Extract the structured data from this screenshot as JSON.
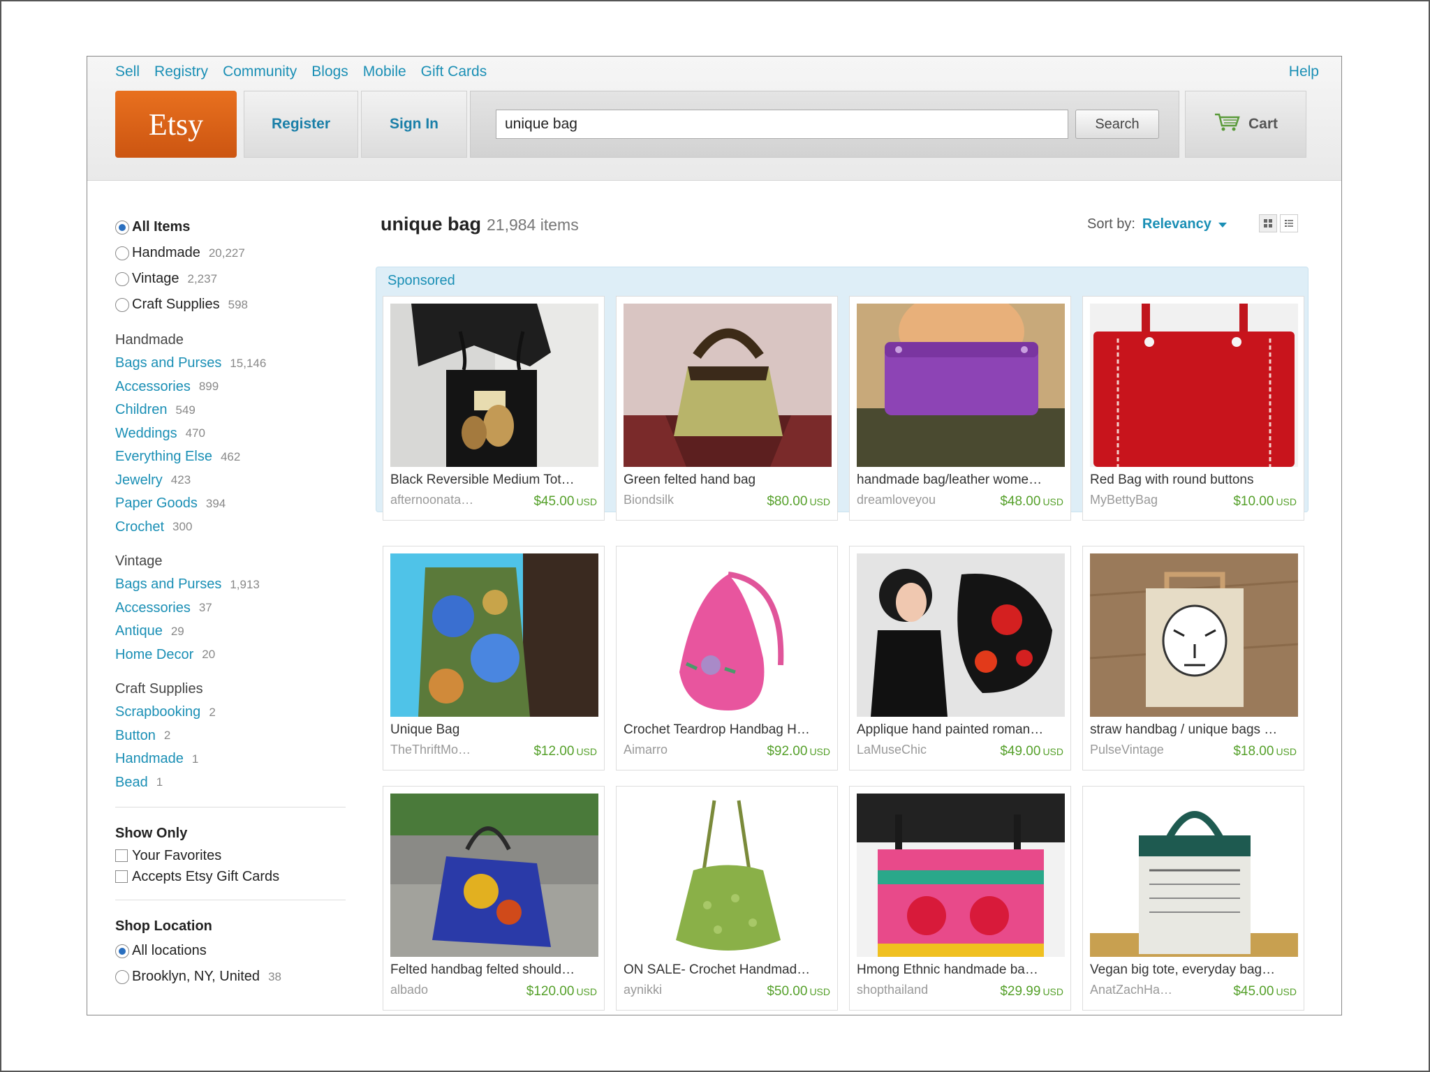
{
  "top_nav": {
    "links": [
      "Sell",
      "Registry",
      "Community",
      "Blogs",
      "Mobile",
      "Gift Cards"
    ],
    "help": "Help"
  },
  "header": {
    "logo": "Etsy",
    "register": "Register",
    "sign_in": "Sign In",
    "search_value": "unique bag",
    "search_button": "Search",
    "cart": "Cart"
  },
  "filters": {
    "types": [
      {
        "label": "All Items",
        "count": "",
        "checked": true
      },
      {
        "label": "Handmade",
        "count": "20,227",
        "checked": false
      },
      {
        "label": "Vintage",
        "count": "2,237",
        "checked": false
      },
      {
        "label": "Craft Supplies",
        "count": "598",
        "checked": false
      }
    ],
    "handmade": {
      "heading": "Handmade",
      "items": [
        {
          "label": "Bags and Purses",
          "count": "15,146"
        },
        {
          "label": "Accessories",
          "count": "899"
        },
        {
          "label": "Children",
          "count": "549"
        },
        {
          "label": "Weddings",
          "count": "470"
        },
        {
          "label": "Everything Else",
          "count": "462"
        },
        {
          "label": "Jewelry",
          "count": "423"
        },
        {
          "label": "Paper Goods",
          "count": "394"
        },
        {
          "label": "Crochet",
          "count": "300"
        }
      ]
    },
    "vintage": {
      "heading": "Vintage",
      "items": [
        {
          "label": "Bags and Purses",
          "count": "1,913"
        },
        {
          "label": "Accessories",
          "count": "37"
        },
        {
          "label": "Antique",
          "count": "29"
        },
        {
          "label": "Home Decor",
          "count": "20"
        }
      ]
    },
    "craft": {
      "heading": "Craft Supplies",
      "items": [
        {
          "label": "Scrapbooking",
          "count": "2"
        },
        {
          "label": "Button",
          "count": "2"
        },
        {
          "label": "Handmade",
          "count": "1"
        },
        {
          "label": "Bead",
          "count": "1"
        }
      ]
    },
    "show_only": {
      "heading": "Show Only",
      "options": [
        "Your Favorites",
        "Accepts Etsy Gift Cards"
      ]
    },
    "shop_location": {
      "heading": "Shop Location",
      "options": [
        {
          "label": "All locations",
          "count": "",
          "checked": true
        },
        {
          "label": "Brooklyn, NY, United",
          "count": "38",
          "checked": false
        }
      ]
    }
  },
  "results": {
    "query": "unique bag",
    "count": "21,984 items",
    "sort_label": "Sort by:",
    "sort_value": "Relevancy",
    "sponsored_label": "Sponsored"
  },
  "listings": [
    {
      "title": "Black Reversible Medium Tot…",
      "shop": "afternoonata…",
      "price": "$45.00",
      "currency": "USD",
      "image": "black-tote-photo"
    },
    {
      "title": "Green felted hand bag",
      "shop": "Biondsilk",
      "price": "$80.00",
      "currency": "USD",
      "image": "green-felted-bag-photo"
    },
    {
      "title": "handmade bag/leather wome…",
      "shop": "dreamloveyou",
      "price": "$48.00",
      "currency": "USD",
      "image": "purple-leather-clutch-photo"
    },
    {
      "title": "Red Bag with round buttons",
      "shop": "MyBettyBag",
      "price": "$10.00",
      "currency": "USD",
      "image": "red-bag-photo"
    },
    {
      "title": "Unique Bag",
      "shop": "TheThriftMo…",
      "price": "$12.00",
      "currency": "USD",
      "image": "floral-bag-photo"
    },
    {
      "title": "Crochet Teardrop Handbag H…",
      "shop": "Aimarro",
      "price": "$92.00",
      "currency": "USD",
      "image": "pink-crochet-bag-photo"
    },
    {
      "title": "Applique hand painted roman…",
      "shop": "LaMuseChic",
      "price": "$49.00",
      "currency": "USD",
      "image": "poppy-bag-model-photo"
    },
    {
      "title": "straw handbag / unique bags …",
      "shop": "PulseVintage",
      "price": "$18.00",
      "currency": "USD",
      "image": "tiger-straw-bag-photo"
    },
    {
      "title": "Felted handbag felted should…",
      "shop": "albado",
      "price": "$120.00",
      "currency": "USD",
      "image": "felted-shoulder-bag-photo"
    },
    {
      "title": "ON SALE- Crochet Handmad…",
      "shop": "aynikki",
      "price": "$50.00",
      "currency": "USD",
      "image": "green-crochet-bag-photo"
    },
    {
      "title": "Hmong Ethnic handmade ba…",
      "shop": "shopthailand",
      "price": "$29.99",
      "currency": "USD",
      "image": "hmong-embroidered-bag-photo"
    },
    {
      "title": "Vegan big tote, everyday bag…",
      "shop": "AnatZachHa…",
      "price": "$45.00",
      "currency": "USD",
      "image": "newspaper-tote-photo"
    }
  ]
}
